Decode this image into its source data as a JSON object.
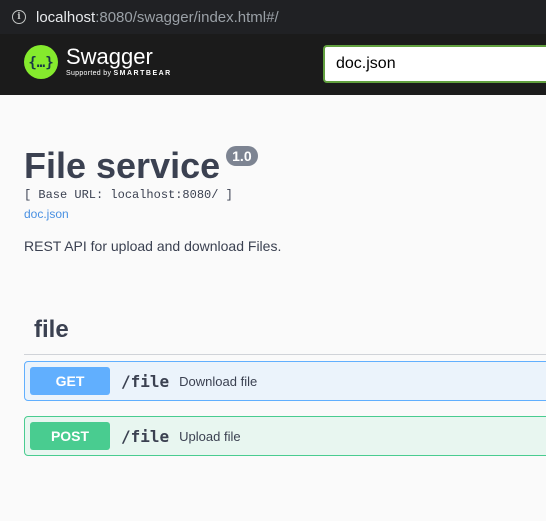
{
  "browser": {
    "url_host": "localhost",
    "url_rest": ":8080/swagger/index.html#/"
  },
  "topbar": {
    "logo_name": "Swagger",
    "logo_sub_prefix": "Supported by ",
    "logo_sub_brand": "SMARTBEAR",
    "spec_url": "doc.json"
  },
  "info": {
    "title": "File service",
    "version": "1.0",
    "base_url": "[ Base URL: localhost:8080/ ]",
    "doc_link": "doc.json",
    "description": "REST API for upload and download Files."
  },
  "tag": {
    "name": "file"
  },
  "operations": [
    {
      "method": "GET",
      "path": "/file",
      "summary": "Download file",
      "color": "#61affe"
    },
    {
      "method": "POST",
      "path": "/file",
      "summary": "Upload file",
      "color": "#49cc90"
    }
  ]
}
